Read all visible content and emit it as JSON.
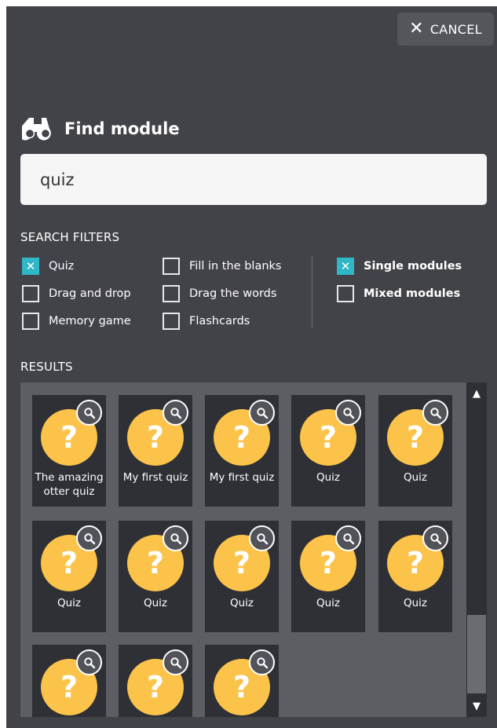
{
  "header": {
    "cancel_label": "CANCEL"
  },
  "title": "Find module",
  "search": {
    "value": "quiz",
    "placeholder": ""
  },
  "filters": {
    "section_label": "SEARCH FILTERS",
    "types": [
      {
        "label": "Quiz",
        "checked": true
      },
      {
        "label": "Fill in the blanks",
        "checked": false
      },
      {
        "label": "Drag and drop",
        "checked": false
      },
      {
        "label": "Drag the words",
        "checked": false
      },
      {
        "label": "Memory game",
        "checked": false
      },
      {
        "label": "Flashcards",
        "checked": false
      }
    ],
    "modes": [
      {
        "label": "Single modules",
        "checked": true
      },
      {
        "label": "Mixed modules",
        "checked": false
      }
    ]
  },
  "results": {
    "section_label": "RESULTS",
    "items": [
      {
        "name": "The amazing otter quiz"
      },
      {
        "name": "My first quiz"
      },
      {
        "name": "My first quiz"
      },
      {
        "name": "Quiz"
      },
      {
        "name": "Quiz"
      },
      {
        "name": "Quiz"
      },
      {
        "name": "Quiz"
      },
      {
        "name": "Quiz"
      },
      {
        "name": "Quiz"
      },
      {
        "name": "Quiz"
      },
      {
        "name": ""
      },
      {
        "name": ""
      },
      {
        "name": ""
      }
    ]
  },
  "icons": {
    "title": "binoculars-icon",
    "cancel": "close-icon",
    "card_badge": "magnifier-icon",
    "card_thumb": "question-mark-icon"
  },
  "colors": {
    "background": "#424349",
    "accent": "#2fb7c8",
    "card": "#2f3036",
    "thumb": "#fbc34a"
  }
}
